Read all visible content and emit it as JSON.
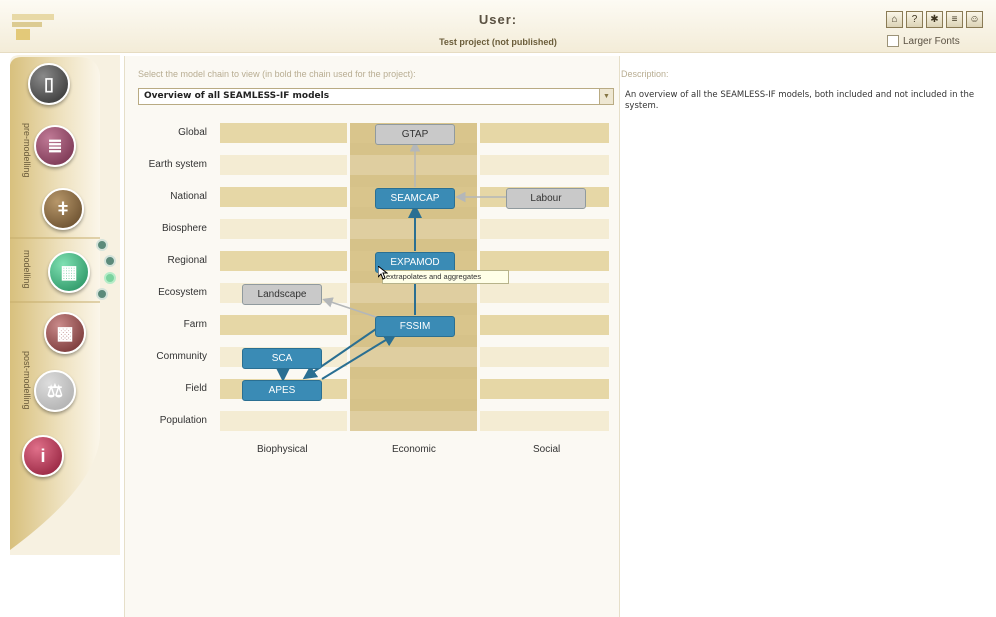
{
  "header": {
    "title": "User:",
    "project": "Test project (not published)",
    "larger_fonts_label": "Larger Fonts",
    "toolbar_icons": [
      "home-icon",
      "help-icon",
      "settings-icon",
      "document-icon",
      "users-icon"
    ]
  },
  "sidebar": {
    "sections": [
      "pre-modelling",
      "modelling",
      "post-modelling"
    ]
  },
  "model_chain": {
    "select_label": "Select the model chain to view (in bold the chain used for the project):",
    "selected": "Overview of all SEAMLESS-IF models"
  },
  "description": {
    "label": "Description:",
    "text": "An overview of all the SEAMLESS-IF models, both included and not included in the system."
  },
  "diagram": {
    "levels": [
      "Global",
      "Earth system",
      "National",
      "Biosphere",
      "Regional",
      "Ecosystem",
      "Farm",
      "Community",
      "Field",
      "Population"
    ],
    "domains": [
      "Biophysical",
      "Economic",
      "Social"
    ],
    "nodes": {
      "gtap": "GTAP",
      "seamcap": "SEAMCAP",
      "labour": "Labour",
      "expamod": "EXPAMOD",
      "landscape": "Landscape",
      "fssim": "FSSIM",
      "sca": "SCA",
      "apes": "APES"
    },
    "tooltip": "extrapolates and aggregates"
  },
  "colors": {
    "active_model": "#3a8bb5",
    "inactive_model": "#c9c9c9",
    "band": "#e6d7a6",
    "economic_column": "#dcc98f"
  }
}
